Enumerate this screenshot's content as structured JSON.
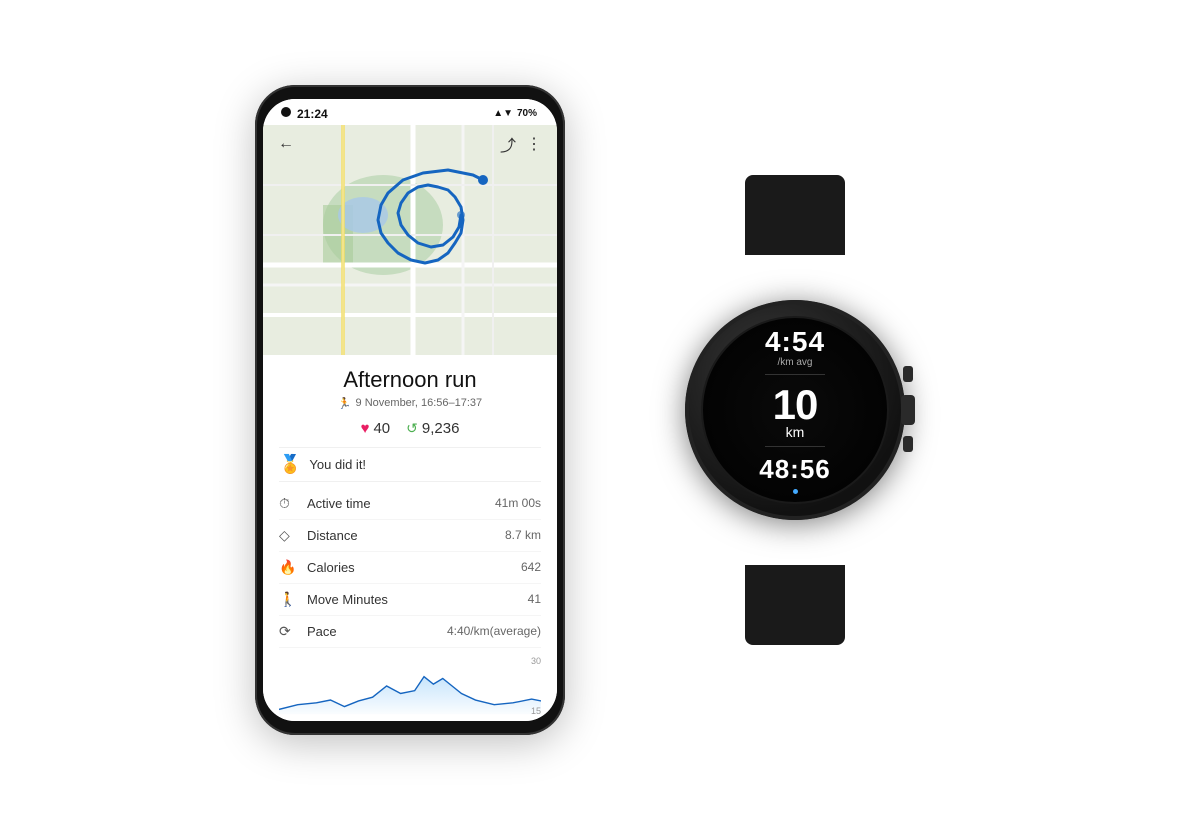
{
  "phone": {
    "status": {
      "time": "21:24",
      "battery": "70%",
      "signal_icon": "▲",
      "wifi_icon": "▼",
      "battery_icon": "▮"
    },
    "toolbar": {
      "back_label": "←",
      "share_label": "⤴",
      "more_label": "⋮"
    },
    "activity": {
      "title": "Afternoon run",
      "date": "9 November, 16:56–17:37",
      "heart_points": "40",
      "steps": "9,236",
      "you_did_it": "You did it!"
    },
    "metrics": [
      {
        "icon": "⏱",
        "label": "Active time",
        "value": "41m 00s"
      },
      {
        "icon": "◇",
        "label": "Distance",
        "value": "8.7 km"
      },
      {
        "icon": "🔥",
        "label": "Calories",
        "value": "642"
      },
      {
        "icon": "🚶",
        "label": "Move Minutes",
        "value": "41"
      },
      {
        "icon": "⟳",
        "label": "Pace",
        "value": "4:40/km(average)"
      }
    ],
    "chart": {
      "label_top": "30",
      "label_bottom": "15"
    }
  },
  "watch": {
    "pace": "4:54",
    "pace_label": "/km avg",
    "distance": "10",
    "distance_unit": "km",
    "time": "48:56"
  }
}
